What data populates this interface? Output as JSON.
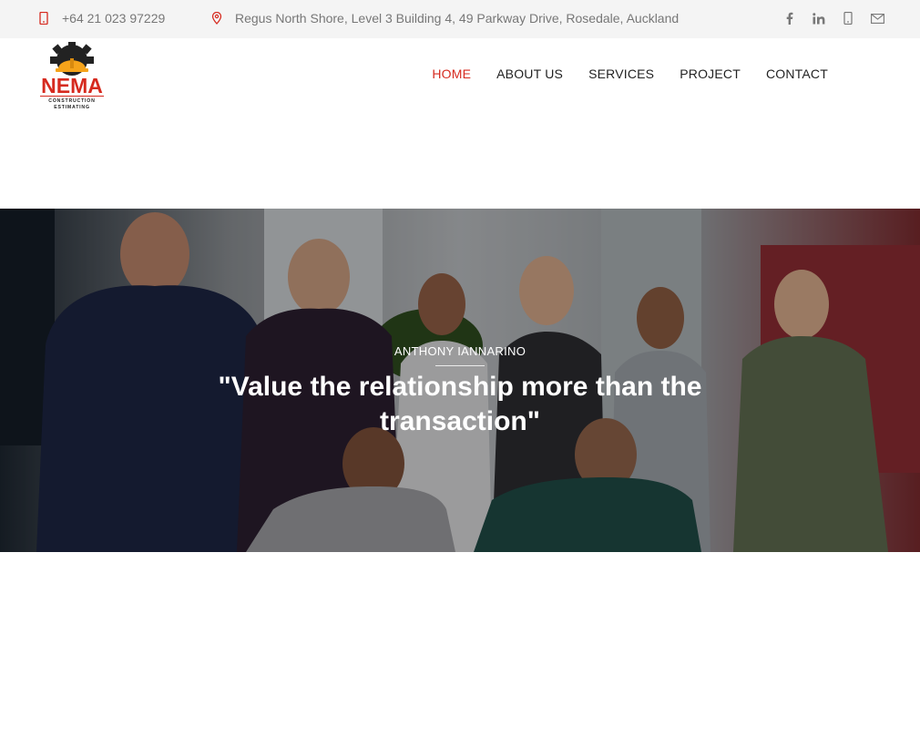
{
  "topbar": {
    "phone": "+64 21 023 97229",
    "address": "Regus North Shore, Level 3 Building 4, 49 Parkway Drive, Rosedale, Auckland",
    "social": [
      {
        "name": "facebook-icon",
        "glyph": "f"
      },
      {
        "name": "linkedin-icon",
        "glyph": "in"
      },
      {
        "name": "mobile-icon",
        "glyph": "▯"
      },
      {
        "name": "mail-icon",
        "glyph": "✉"
      }
    ]
  },
  "logo": {
    "name": "NEMA",
    "line1": "CONSTRUCTION",
    "line2": "ESTIMATING"
  },
  "nav": {
    "items": [
      {
        "label": "HOME",
        "active": true
      },
      {
        "label": "ABOUT US",
        "active": false
      },
      {
        "label": "SERVICES",
        "active": false
      },
      {
        "label": "PROJECT",
        "active": false
      },
      {
        "label": "CONTACT",
        "active": false
      }
    ]
  },
  "hero": {
    "author": "ANTHONY IANNARINO",
    "quote": "\"Value the relationship more than the transaction\""
  },
  "colors": {
    "accent": "#d62a1f",
    "topbar_bg": "#f4f4f4",
    "logo_orange": "#f5a31a"
  }
}
